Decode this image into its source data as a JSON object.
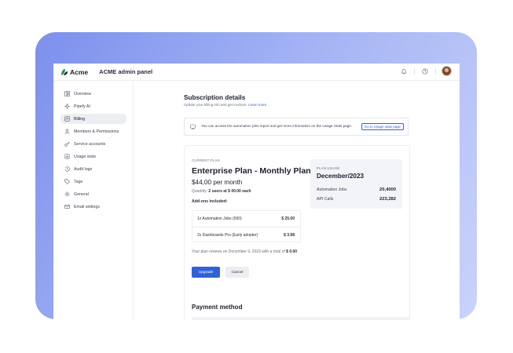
{
  "app": {
    "brand": "Acme",
    "panel_title": "ACME admin panel"
  },
  "sidebar": {
    "items": [
      {
        "label": "Overview",
        "icon": "overview-icon",
        "active": false
      },
      {
        "label": "Pipefy AI",
        "icon": "sparkle-icon",
        "active": false
      },
      {
        "label": "Billing",
        "icon": "billing-icon",
        "active": true
      },
      {
        "label": "Members & Permissions",
        "icon": "members-icon",
        "active": false
      },
      {
        "label": "Service accounts",
        "icon": "key-icon",
        "active": false
      },
      {
        "label": "Usage stats",
        "icon": "chart-icon",
        "active": false
      },
      {
        "label": "Audit logs",
        "icon": "history-icon",
        "active": false
      },
      {
        "label": "Tags",
        "icon": "tag-icon",
        "active": false
      },
      {
        "label": "General",
        "icon": "gear-icon",
        "active": false
      },
      {
        "label": "Email settings",
        "icon": "mail-icon",
        "active": false
      }
    ]
  },
  "page": {
    "title": "Subscription details",
    "subtitle": "Update your billing info and get invoices.",
    "learn_more": "Learn more."
  },
  "notice": {
    "text": "You can access the automation jobs report and get more information on the Usage Stats page.",
    "button": "Go to Usage stats page"
  },
  "plan": {
    "label": "CURRENT PLAN",
    "name": "Enterprise Plan - Monthly Plan",
    "price": "$44,00 per month",
    "quantity_prefix": "Quantity:",
    "quantity_value": "2 users at $ 00.00 each",
    "addons_title": "Add-ons included:",
    "addons": [
      {
        "name": "1x Automation Jobs (500)",
        "price": "$ 25.00"
      },
      {
        "name": "2x Dashboards Pro (Early adopter)",
        "price": "$ 3.98"
      }
    ],
    "renew_text": "Your plan renews on December 9, 2023 with a total of",
    "renew_amount": "$ 0.00",
    "upgrade_label": "Upgrade",
    "cancel_label": "Cancel"
  },
  "usage": {
    "label": "PLAN USAGE",
    "month": "December/2023",
    "rows": [
      {
        "name": "Automation Jobs",
        "value": "20,4000"
      },
      {
        "name": "API Calls",
        "value": "223,282"
      }
    ]
  },
  "payment": {
    "title": "Payment method"
  },
  "colors": {
    "accent": "#2f62d6",
    "brand_green": "#1e9a55",
    "frame_gradient_start": "#7c90ec",
    "frame_gradient_end": "#c9d3fa"
  }
}
